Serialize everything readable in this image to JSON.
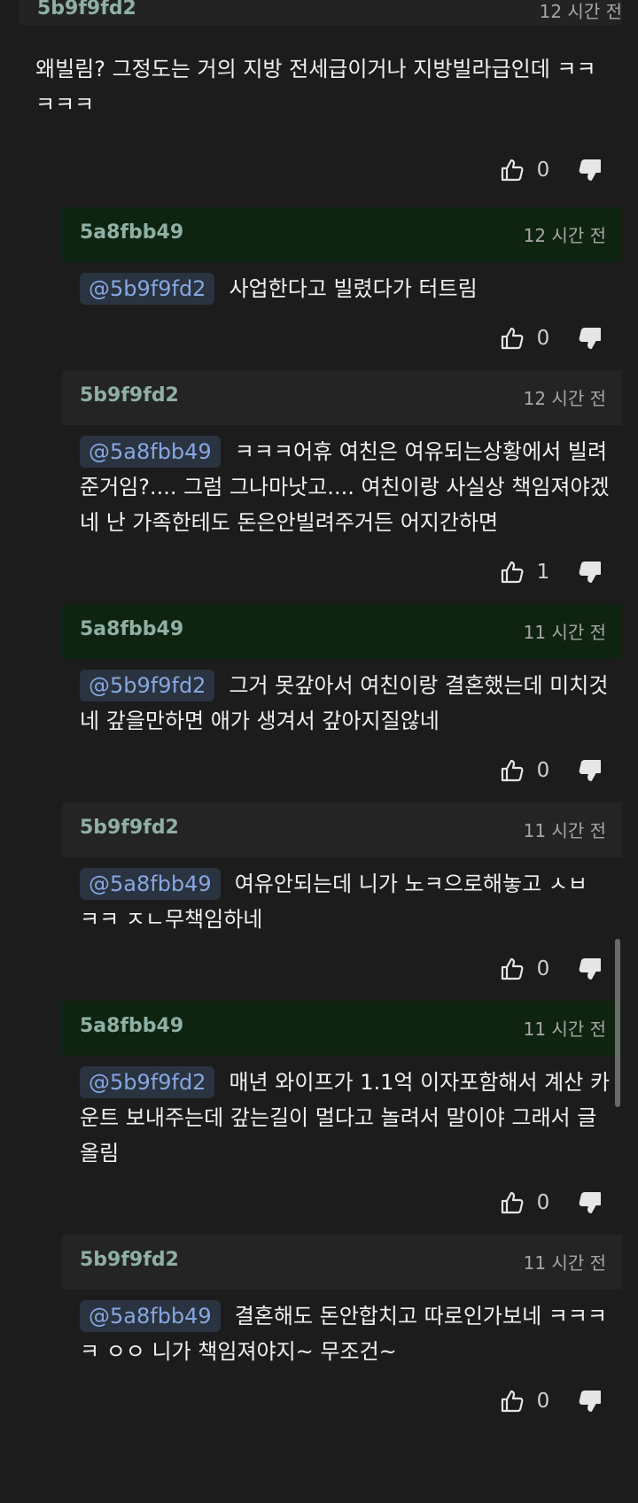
{
  "top_comment": {
    "author": "5b9f9fd2",
    "time": "12 시간 전",
    "text": "왜빌림? 그정도는 거의 지방 전세급이거나 지방빌라급인데 ㅋㅋㅋㅋㅋ",
    "likes": "0"
  },
  "replies": [
    {
      "author": "5a8fbb49",
      "time": "12 시간 전",
      "mention": "@5b9f9fd2",
      "text": "사업한다고 빌렸다가 터트림",
      "likes": "0",
      "style": "green"
    },
    {
      "author": "5b9f9fd2",
      "time": "12 시간 전",
      "mention": "@5a8fbb49",
      "text": "ㅋㅋㅋ어휴 여친은 여유되는상황에서 빌려준거임?.... 그럼 그나마낫고.... 여친이랑 사실상 책임져야겠네 난 가족한테도 돈은안빌려주거든 어지간하면",
      "likes": "1",
      "style": "grey"
    },
    {
      "author": "5a8fbb49",
      "time": "11 시간 전",
      "mention": "@5b9f9fd2",
      "text": "그거 못갚아서 여친이랑 결혼했는데 미치것네 갚을만하면 애가 생겨서 갚아지질않네",
      "likes": "0",
      "style": "green"
    },
    {
      "author": "5b9f9fd2",
      "time": "11 시간 전",
      "mention": "@5a8fbb49",
      "text": "여유안되는데 니가 노ㅋ으로해놓고 ㅅㅂ ㅋㅋ ㅈㄴ무책임하네",
      "likes": "0",
      "style": "grey"
    },
    {
      "author": "5a8fbb49",
      "time": "11 시간 전",
      "mention": "@5b9f9fd2",
      "text": "매년 와이프가 1.1억 이자포함해서 계산 카운트 보내주는데 갚는길이 멀다고 놀려서 말이야 그래서 글올림",
      "likes": "0",
      "style": "green"
    },
    {
      "author": "5b9f9fd2",
      "time": "11 시간 전",
      "mention": "@5a8fbb49",
      "text": "결혼해도 돈안합치고 따로인가보네 ㅋㅋㅋㅋ ㅇㅇ 니가 책임져야지~ 무조건~",
      "likes": "0",
      "style": "grey"
    }
  ],
  "icons": {
    "like": "thumbs-up-icon",
    "dislike": "thumbs-down-icon"
  },
  "colors": {
    "background": "#1c1c1c",
    "author": "#8fb0a4",
    "mention_text": "#86a7e0",
    "green_header": "#0e2410"
  }
}
